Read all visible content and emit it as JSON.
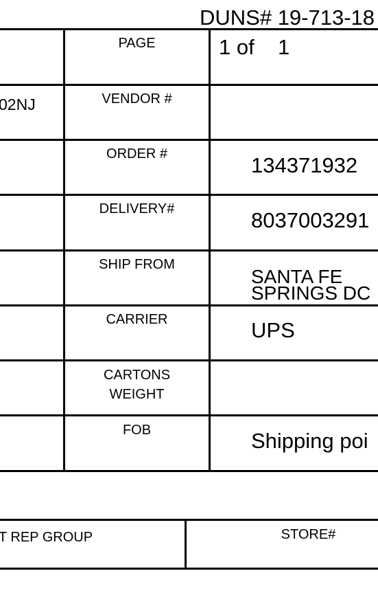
{
  "header": {
    "duns": "DUNS# 19-713-18"
  },
  "form": {
    "left_fragment": "02NJ",
    "page": {
      "label": "PAGE",
      "current": "1 of",
      "total": "1"
    },
    "vendor": {
      "label": "VENDOR #",
      "value": ""
    },
    "order": {
      "label": "ORDER #",
      "value": "134371932"
    },
    "delivery": {
      "label": "DELIVERY#",
      "value": "8037003291"
    },
    "ship_from": {
      "label": "SHIP FROM",
      "line1": "SANTA FE",
      "line2": "SPRINGS DC"
    },
    "carrier": {
      "label": "CARRIER",
      "value": "UPS"
    },
    "cartons_weight": {
      "label_line1": "CARTONS",
      "label_line2": "WEIGHT",
      "value": ""
    },
    "fob": {
      "label": "FOB",
      "value": "Shipping poi"
    }
  },
  "bottom": {
    "rep_group_label": "T REP GROUP",
    "store_label": "STORE#"
  }
}
